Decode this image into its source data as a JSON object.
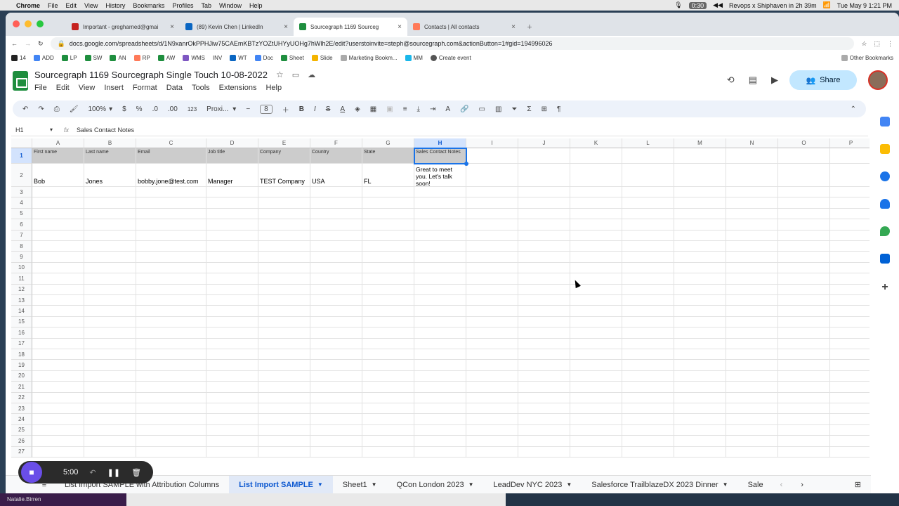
{
  "mac": {
    "apple": "",
    "app": "Chrome",
    "menus": [
      "File",
      "Edit",
      "View",
      "History",
      "Bookmarks",
      "Profiles",
      "Tab",
      "Window",
      "Help"
    ],
    "rec_time": "0:30",
    "event": "Revops x Shiphaven in 2h 39m",
    "clock": "Tue May 9  1:21 PM"
  },
  "tabs": [
    {
      "title": "Important - gregharned@gmai",
      "color": "#c5221f"
    },
    {
      "title": "(89) Kevin Chen | LinkedIn",
      "color": "#0a66c2"
    },
    {
      "title": "Sourcegraph 1169 Sourceg",
      "color": "#1e8e3e"
    },
    {
      "title": "Contacts | All contacts",
      "color": "#ff7a59"
    }
  ],
  "url": "docs.google.com/spreadsheets/d/1N9xanrOkPPHJiw75CAEmKBTzYOZtUHYyUOHg7hWlh2E/edit?userstoinvite=steph@sourcegraph.com&actionButton=1#gid=194996026",
  "bookmarks": [
    "14",
    "ADD",
    "LP",
    "SW",
    "AN",
    "RP",
    "AW",
    "WMS",
    "INV",
    "WT",
    "Doc",
    "Sheet",
    "Slide",
    "Marketing Bookm...",
    "MM",
    "Create event"
  ],
  "other_bookmarks": "Other Bookmarks",
  "doc": {
    "title": "Sourcegraph 1169 Sourcegraph Single Touch 10-08-2022",
    "menus": [
      "File",
      "Edit",
      "View",
      "Insert",
      "Format",
      "Data",
      "Tools",
      "Extensions",
      "Help"
    ],
    "share": "Share"
  },
  "toolbar": {
    "zoom": "100%",
    "currency": "$",
    "percent": "%",
    "dec_less": ".0",
    "dec_more": ".00",
    "num": "123",
    "font": "Proxi...",
    "font_size": "8"
  },
  "namebox": "H1",
  "formula": "Sales Contact Notes",
  "columns": [
    "A",
    "B",
    "C",
    "D",
    "E",
    "F",
    "G",
    "H",
    "I",
    "J",
    "K",
    "L",
    "M",
    "N",
    "O",
    "P"
  ],
  "rows": [
    "1",
    "2",
    "3",
    "4",
    "5",
    "6",
    "7",
    "8",
    "9",
    "10",
    "11",
    "12",
    "13",
    "14",
    "15",
    "16",
    "17",
    "18",
    "19",
    "20",
    "21",
    "22",
    "23",
    "24",
    "25",
    "26",
    "27"
  ],
  "header_row": [
    "First name",
    "Last name",
    "Email",
    "Job title",
    "Company",
    "Country",
    "State",
    "Sales Contact Notes"
  ],
  "data_row": [
    "Bob",
    "Jones",
    "bobby.jone@test.com",
    "Manager",
    "TEST Company",
    "USA",
    "FL",
    "Great to meet you. Let's talk soon!"
  ],
  "sheet_tabs": [
    "List Import SAMPLE with Attribution Columns",
    "List Import SAMPLE",
    "Sheet1",
    "QCon London 2023",
    "LeadDev NYC 2023",
    "Salesforce TrailblazeDX 2023 Dinner",
    "Sale"
  ],
  "recorder_time": "5:00",
  "dock_user": "Natalie.Birren"
}
